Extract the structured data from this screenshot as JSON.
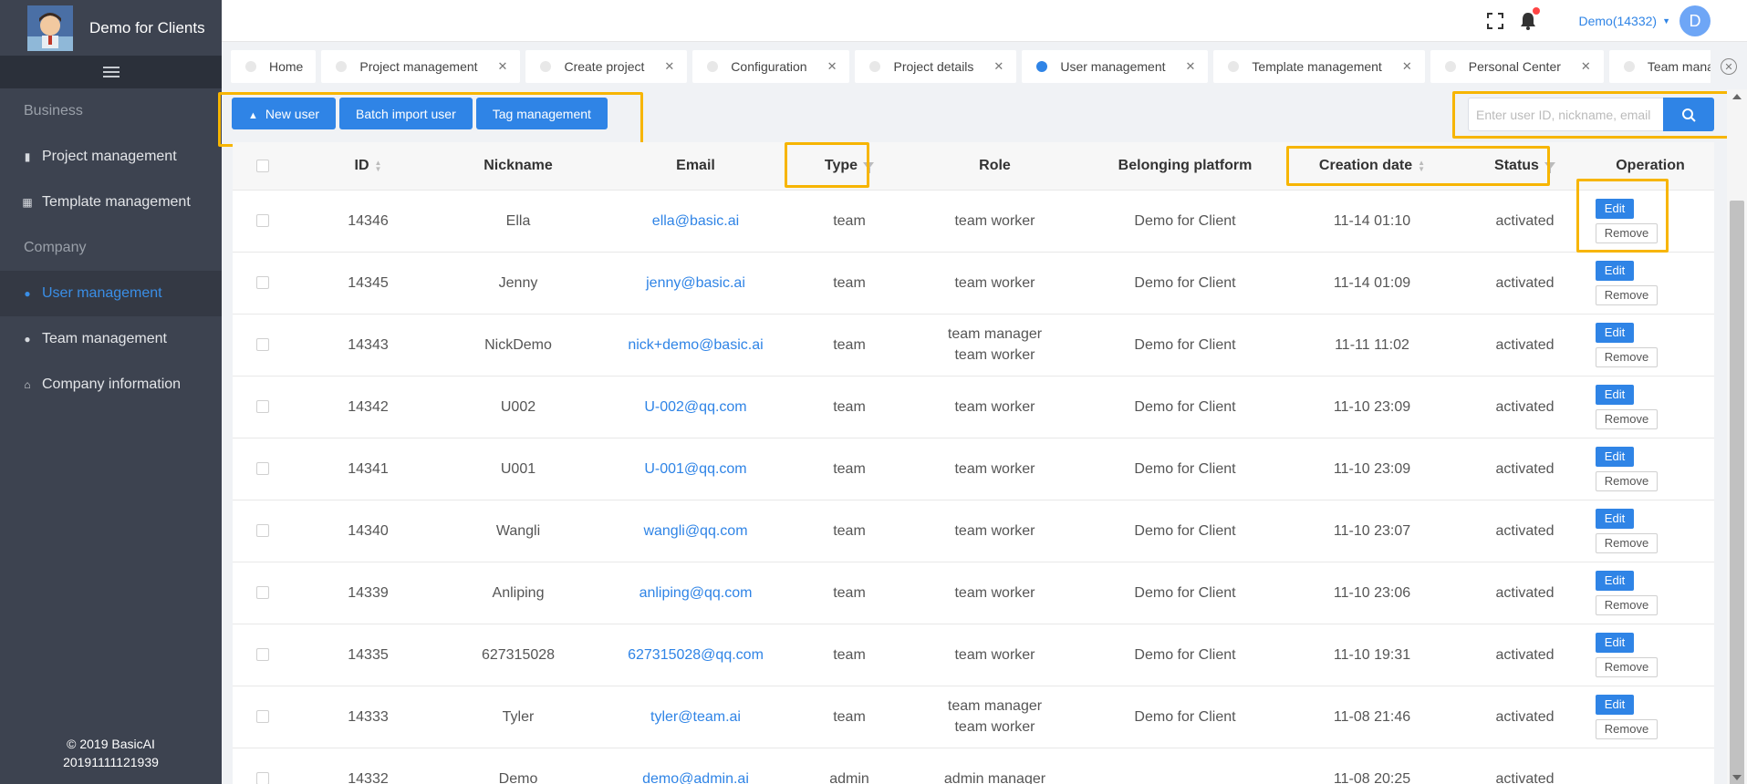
{
  "brand": {
    "name": "Demo for Clients"
  },
  "sidebar": {
    "sections": [
      {
        "title": "Business",
        "items": [
          {
            "label": "Project management",
            "icon": "book-icon"
          },
          {
            "label": "Template management",
            "icon": "grid-icon"
          }
        ]
      },
      {
        "title": "Company",
        "items": [
          {
            "label": "User management",
            "icon": "users-icon",
            "active": true
          },
          {
            "label": "Team management",
            "icon": "team-icon"
          },
          {
            "label": "Company information",
            "icon": "home-icon"
          }
        ]
      }
    ],
    "footer_line1": "© 2019 BasicAI",
    "footer_line2": "20191111121939"
  },
  "header": {
    "user_label": "Demo(14332)",
    "avatar_letter": "D"
  },
  "tabs": [
    {
      "label": "Home",
      "closable": false
    },
    {
      "label": "Project management",
      "closable": true
    },
    {
      "label": "Create project",
      "closable": true
    },
    {
      "label": "Configuration",
      "closable": true
    },
    {
      "label": "Project details",
      "closable": true
    },
    {
      "label": "User management",
      "closable": true,
      "active": true
    },
    {
      "label": "Template management",
      "closable": true
    },
    {
      "label": "Personal Center",
      "closable": true
    },
    {
      "label": "Team managem",
      "closable": true
    }
  ],
  "toolbar": {
    "new_user_label": "New user",
    "batch_import_label": "Batch import user",
    "tag_management_label": "Tag management"
  },
  "search": {
    "placeholder": "Enter user ID, nickname, email",
    "value": ""
  },
  "table": {
    "headers": {
      "id": "ID",
      "nickname": "Nickname",
      "email": "Email",
      "type": "Type",
      "role": "Role",
      "platform": "Belonging platform",
      "created": "Creation date",
      "status": "Status",
      "operation": "Operation"
    },
    "edit_label": "Edit",
    "remove_label": "Remove",
    "rows": [
      {
        "id": "14346",
        "nickname": "Ella",
        "email": "ella@basic.ai",
        "type": "team",
        "role": [
          "team worker"
        ],
        "platform": "Demo for Client",
        "created": "11-14 01:10",
        "status": "activated"
      },
      {
        "id": "14345",
        "nickname": "Jenny",
        "email": "jenny@basic.ai",
        "type": "team",
        "role": [
          "team worker"
        ],
        "platform": "Demo for Client",
        "created": "11-14 01:09",
        "status": "activated"
      },
      {
        "id": "14343",
        "nickname": "NickDemo",
        "email": "nick+demo@basic.ai",
        "type": "team",
        "role": [
          "team manager",
          "team worker"
        ],
        "platform": "Demo for Client",
        "created": "11-11 11:02",
        "status": "activated"
      },
      {
        "id": "14342",
        "nickname": "U002",
        "email": "U-002@qq.com",
        "type": "team",
        "role": [
          "team worker"
        ],
        "platform": "Demo for Client",
        "created": "11-10 23:09",
        "status": "activated"
      },
      {
        "id": "14341",
        "nickname": "U001",
        "email": "U-001@qq.com",
        "type": "team",
        "role": [
          "team worker"
        ],
        "platform": "Demo for Client",
        "created": "11-10 23:09",
        "status": "activated"
      },
      {
        "id": "14340",
        "nickname": "Wangli",
        "email": "wangli@qq.com",
        "type": "team",
        "role": [
          "team worker"
        ],
        "platform": "Demo for Client",
        "created": "11-10 23:07",
        "status": "activated"
      },
      {
        "id": "14339",
        "nickname": "Anliping",
        "email": "anliping@qq.com",
        "type": "team",
        "role": [
          "team worker"
        ],
        "platform": "Demo for Client",
        "created": "11-10 23:06",
        "status": "activated"
      },
      {
        "id": "14335",
        "nickname": "627315028",
        "email": "627315028@qq.com",
        "type": "team",
        "role": [
          "team worker"
        ],
        "platform": "Demo for Client",
        "created": "11-10 19:31",
        "status": "activated"
      },
      {
        "id": "14333",
        "nickname": "Tyler",
        "email": "tyler@team.ai",
        "type": "team",
        "role": [
          "team manager",
          "team worker"
        ],
        "platform": "Demo for Client",
        "created": "11-08 21:46",
        "status": "activated"
      },
      {
        "id": "14332",
        "nickname": "Demo",
        "email": "demo@admin.ai",
        "type": "admin",
        "role": [
          "admin manager",
          ""
        ],
        "platform": "",
        "created": "11-08 20:25",
        "status": "activated",
        "no_ops": true
      }
    ]
  },
  "colors": {
    "primary": "#2f84e6",
    "sidebar_bg": "#3d4350",
    "highlight": "#f7b500"
  }
}
